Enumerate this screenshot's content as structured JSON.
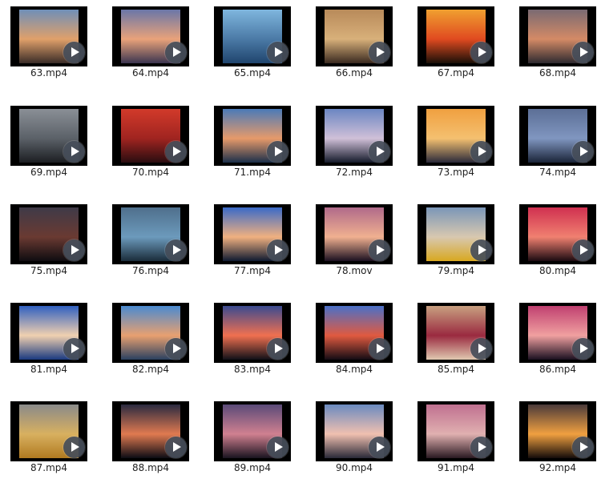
{
  "files": [
    {
      "name": "63.mp4",
      "icon": "play-icon",
      "colors": [
        "#6f8fb8",
        "#e0a06a",
        "#3a2c28"
      ]
    },
    {
      "name": "64.mp4",
      "icon": "play-icon",
      "colors": [
        "#6a76a8",
        "#e9a27a",
        "#3c3550"
      ]
    },
    {
      "name": "65.mp4",
      "icon": "play-icon",
      "colors": [
        "#7fb6de",
        "#4b7aa6",
        "#20456e"
      ]
    },
    {
      "name": "66.mp4",
      "icon": "play-icon",
      "colors": [
        "#b88a5a",
        "#d8b07a",
        "#3a2a20"
      ]
    },
    {
      "name": "67.mp4",
      "icon": "play-icon",
      "colors": [
        "#f0a030",
        "#e04a20",
        "#1a1008"
      ]
    },
    {
      "name": "68.mp4",
      "icon": "play-icon",
      "colors": [
        "#7a6a72",
        "#d48a66",
        "#2e2a30"
      ]
    },
    {
      "name": "69.mp4",
      "icon": "play-icon",
      "colors": [
        "#8a8f96",
        "#5b6168",
        "#1c1e22"
      ]
    },
    {
      "name": "70.mp4",
      "icon": "play-icon",
      "colors": [
        "#d23a2a",
        "#a02420",
        "#2a0d10"
      ]
    },
    {
      "name": "71.mp4",
      "icon": "play-icon",
      "colors": [
        "#4a7ab8",
        "#e69a6a",
        "#1b2f4a"
      ]
    },
    {
      "name": "72.mp4",
      "icon": "play-icon",
      "colors": [
        "#6b86c2",
        "#d0c0d8",
        "#141a2a"
      ]
    },
    {
      "name": "73.mp4",
      "icon": "play-icon",
      "colors": [
        "#f0a040",
        "#f4c070",
        "#2a2a3a"
      ]
    },
    {
      "name": "74.mp4",
      "icon": "play-icon",
      "colors": [
        "#5c6f96",
        "#8096c0",
        "#1a2438"
      ]
    },
    {
      "name": "75.mp4",
      "icon": "play-icon",
      "colors": [
        "#3f3a48",
        "#6a3a32",
        "#0e0c10"
      ]
    },
    {
      "name": "76.mp4",
      "icon": "play-icon",
      "colors": [
        "#4f6f8c",
        "#6c9abc",
        "#1a2c3a"
      ]
    },
    {
      "name": "77.mp4",
      "icon": "play-icon",
      "colors": [
        "#3a6ac8",
        "#f0b080",
        "#0e1a30"
      ]
    },
    {
      "name": "78.mov",
      "icon": "play-icon",
      "colors": [
        "#b06a8a",
        "#f0b090",
        "#1a1020"
      ]
    },
    {
      "name": "79.mp4",
      "icon": "play-icon",
      "colors": [
        "#7a96b8",
        "#d8c8b0",
        "#d8a820"
      ]
    },
    {
      "name": "80.mp4",
      "icon": "play-icon",
      "colors": [
        "#d03050",
        "#f08070",
        "#1a0a10"
      ]
    },
    {
      "name": "81.mp4",
      "icon": "play-icon",
      "colors": [
        "#3060c0",
        "#f0d0b0",
        "#1a3a80"
      ]
    },
    {
      "name": "82.mp4",
      "icon": "play-icon",
      "colors": [
        "#4a8ad0",
        "#e8a070",
        "#2a4060"
      ]
    },
    {
      "name": "83.mp4",
      "icon": "play-icon",
      "colors": [
        "#3a4a90",
        "#f07050",
        "#101018"
      ]
    },
    {
      "name": "84.mp4",
      "icon": "play-icon",
      "colors": [
        "#4a70c8",
        "#e05a40",
        "#140c14"
      ]
    },
    {
      "name": "85.mp4",
      "icon": "play-icon",
      "colors": [
        "#c8a080",
        "#9a2a40",
        "#e0c8b0"
      ]
    },
    {
      "name": "86.mp4",
      "icon": "play-icon",
      "colors": [
        "#c04070",
        "#f0a0a0",
        "#1a1020"
      ]
    },
    {
      "name": "87.mp4",
      "icon": "play-icon",
      "colors": [
        "#8a8a8a",
        "#d8b060",
        "#b07a20"
      ]
    },
    {
      "name": "88.mp4",
      "icon": "play-icon",
      "colors": [
        "#2a2a40",
        "#e07a50",
        "#0c0c14"
      ]
    },
    {
      "name": "89.mp4",
      "icon": "play-icon",
      "colors": [
        "#5a4a78",
        "#d08090",
        "#1a1420"
      ]
    },
    {
      "name": "90.mp4",
      "icon": "play-icon",
      "colors": [
        "#6a8ac0",
        "#f0c0b0",
        "#2a2a38"
      ]
    },
    {
      "name": "91.mp4",
      "icon": "play-icon",
      "colors": [
        "#c07090",
        "#e0b0b0",
        "#2a1a22"
      ]
    },
    {
      "name": "92.mp4",
      "icon": "play-icon",
      "colors": [
        "#4a3a3a",
        "#f0a040",
        "#140c0a"
      ]
    }
  ]
}
